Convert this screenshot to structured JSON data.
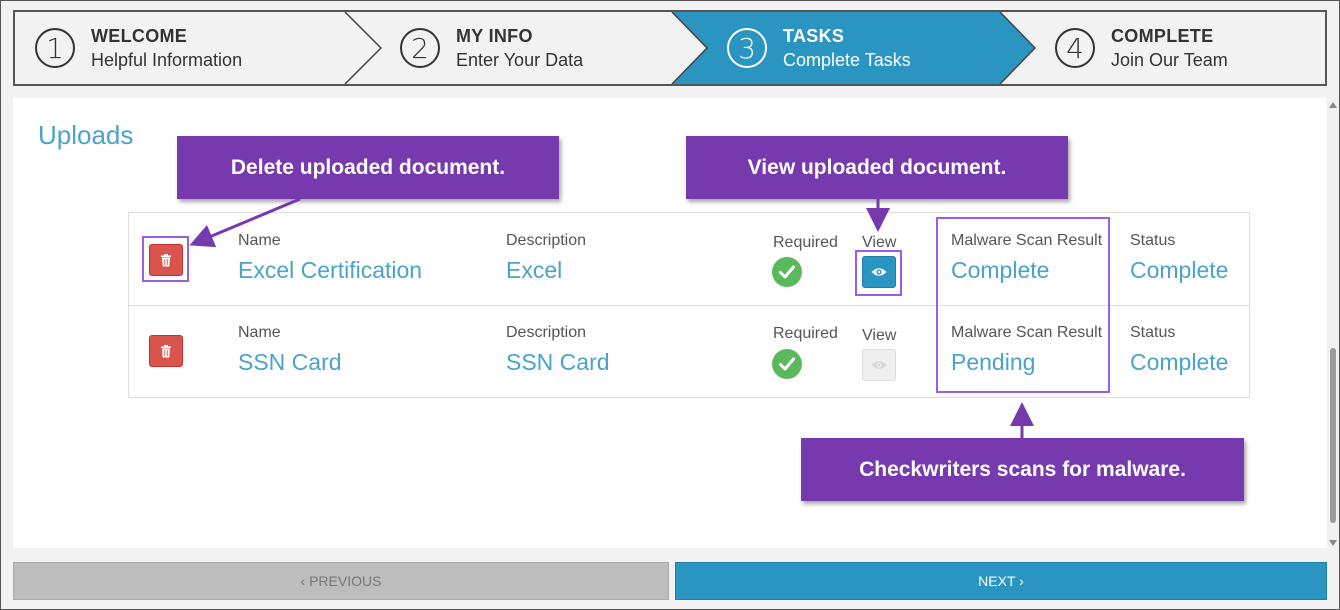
{
  "wizard": {
    "steps": [
      {
        "number": "1",
        "title": "WELCOME",
        "subtitle": "Helpful Information",
        "active": false
      },
      {
        "number": "2",
        "title": "MY INFO",
        "subtitle": "Enter Your Data",
        "active": false
      },
      {
        "number": "3",
        "title": "TASKS",
        "subtitle": "Complete Tasks",
        "active": true
      },
      {
        "number": "4",
        "title": "COMPLETE",
        "subtitle": "Join Our Team",
        "active": false
      }
    ],
    "active_color": "#2a95c1"
  },
  "uploads": {
    "title": "Uploads",
    "columns": {
      "name": "Name",
      "description": "Description",
      "required": "Required",
      "view": "View",
      "malware": "Malware Scan Result",
      "status": "Status"
    },
    "rows": [
      {
        "name": "Excel Certification",
        "description": "Excel",
        "required": true,
        "view_enabled": true,
        "malware": "Complete",
        "status": "Complete"
      },
      {
        "name": "SSN Card",
        "description": "SSN Card",
        "required": true,
        "view_enabled": false,
        "malware": "Pending",
        "status": "Complete"
      }
    ]
  },
  "callouts": {
    "delete": "Delete uploaded document.",
    "view": "View uploaded document.",
    "malware": "Checkwriters scans for malware."
  },
  "footer": {
    "previous_label": "‹ PREVIOUS",
    "next_label": "NEXT ›"
  },
  "colors": {
    "accent": "#2a95c1",
    "link": "#4aa3c8",
    "callout": "#7639ae",
    "highlight": "#9b5de5",
    "delete": "#d9534f",
    "success": "#5cb85c"
  }
}
